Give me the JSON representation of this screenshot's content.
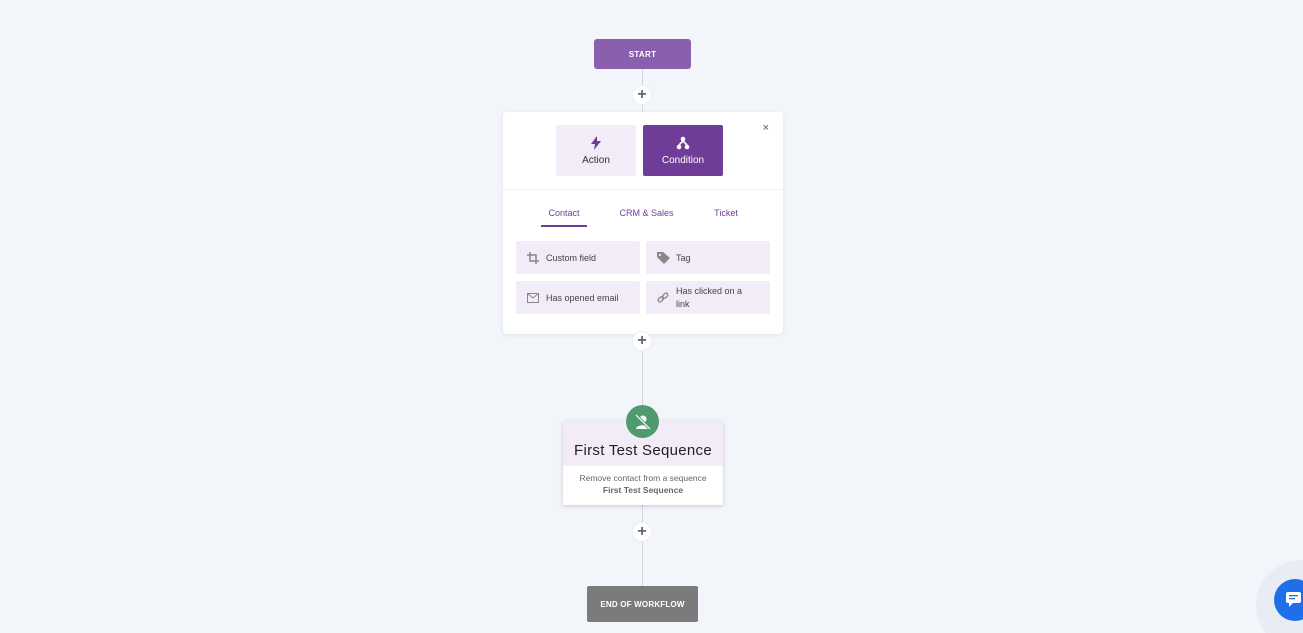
{
  "workflow": {
    "start_label": "START",
    "end_label": "END OF WORKFLOW",
    "add_symbol": "+"
  },
  "picker": {
    "close_label": "×",
    "types": [
      {
        "label": "Action",
        "icon": "lightning-icon",
        "selected": false
      },
      {
        "label": "Condition",
        "icon": "branch-icon",
        "selected": true
      }
    ],
    "tabs": [
      {
        "label": "Contact",
        "active": true
      },
      {
        "label": "CRM & Sales",
        "active": false
      },
      {
        "label": "Ticket",
        "active": false
      }
    ],
    "options": [
      {
        "label": "Custom field",
        "icon": "crop-icon"
      },
      {
        "label": "Tag",
        "icon": "tag-icon"
      },
      {
        "label": "Has opened email",
        "icon": "envelope-icon"
      },
      {
        "label": "Has clicked on a link",
        "icon": "link-icon"
      }
    ]
  },
  "sequence_step": {
    "title": "First Test Sequence",
    "description": "Remove contact from a sequence",
    "sequence_name": "First Test Sequence",
    "icon": "remove-user-icon"
  },
  "colors": {
    "accent": "#6f3d98",
    "start": "#8a5fae",
    "light_accent": "#f2ebf8",
    "badge": "#4f9b6f",
    "end": "#7b7b7b",
    "chat": "#1f6fe8"
  }
}
